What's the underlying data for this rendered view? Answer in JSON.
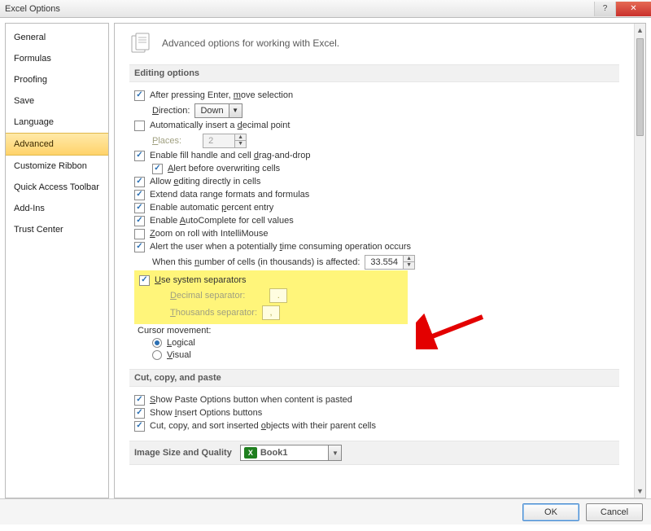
{
  "window": {
    "title": "Excel Options"
  },
  "sidebar": {
    "items": [
      {
        "label": "General"
      },
      {
        "label": "Formulas"
      },
      {
        "label": "Proofing"
      },
      {
        "label": "Save"
      },
      {
        "label": "Language"
      },
      {
        "label": "Advanced",
        "selected": true
      },
      {
        "label": "Customize Ribbon"
      },
      {
        "label": "Quick Access Toolbar"
      },
      {
        "label": "Add-Ins"
      },
      {
        "label": "Trust Center"
      }
    ]
  },
  "header": {
    "text": "Advanced options for working with Excel."
  },
  "sections": {
    "editing": {
      "title": "Editing options",
      "after_enter_pre": "After pressing Enter, ",
      "after_enter_u": "m",
      "after_enter_post": "ove selection",
      "direction_label_u": "D",
      "direction_label_post": "irection:",
      "direction_value": "Down",
      "auto_decimal_pre": "Automatically insert a ",
      "auto_decimal_u": "d",
      "auto_decimal_post": "ecimal point",
      "places_label_u": "P",
      "places_label_post": "laces:",
      "places_value": "2",
      "fill_handle_pre": "Enable fill handle and cell ",
      "fill_handle_u": "d",
      "fill_handle_post": "rag-and-drop",
      "alert_overwrite_u": "A",
      "alert_overwrite_post": "lert before overwriting cells",
      "allow_edit_pre": "Allow ",
      "allow_edit_u": "e",
      "allow_edit_post": "diting directly in cells",
      "extend_formats": "Extend data range formats and formulas",
      "percent_pre": "Enable automatic ",
      "percent_u": "p",
      "percent_post": "ercent entry",
      "autocomplete_pre": "Enable ",
      "autocomplete_u": "A",
      "autocomplete_post": "utoComplete for cell values",
      "zoom_pre": "",
      "zoom_u": "Z",
      "zoom_post": "oom on roll with IntelliMouse",
      "alert_time_pre": "Alert the user when a potentially ",
      "alert_time_u": "t",
      "alert_time_post": "ime consuming operation occurs",
      "num_cells_pre": "When this ",
      "num_cells_u": "n",
      "num_cells_post": "umber of cells (in thousands) is affected:",
      "num_cells_value": "33.554",
      "use_sep_u": "U",
      "use_sep_post": "se system separators",
      "dec_sep_u": "D",
      "dec_sep_post": "ecimal separator:",
      "dec_sep_value": ".",
      "thou_sep_u": "T",
      "thou_sep_post": "housands separator:",
      "thou_sep_value": ",",
      "cursor_label": "Cursor movement:",
      "cursor_logical_u": "L",
      "cursor_logical_post": "ogical",
      "cursor_visual_u": "V",
      "cursor_visual_post": "isual"
    },
    "ccp": {
      "title": "Cut, copy, and paste",
      "show_paste_u": "S",
      "show_paste_post": "how Paste Options button when content is pasted",
      "show_insert_pre": "Show ",
      "show_insert_u": "I",
      "show_insert_post": "nsert Options buttons",
      "cut_sort_pre": "Cut, copy, and sort inserted ",
      "cut_sort_u": "o",
      "cut_sort_post": "bjects with their parent cells"
    },
    "image": {
      "title": "Image Size and Quality",
      "book": "Book1"
    }
  },
  "buttons": {
    "ok": "OK",
    "cancel": "Cancel"
  }
}
